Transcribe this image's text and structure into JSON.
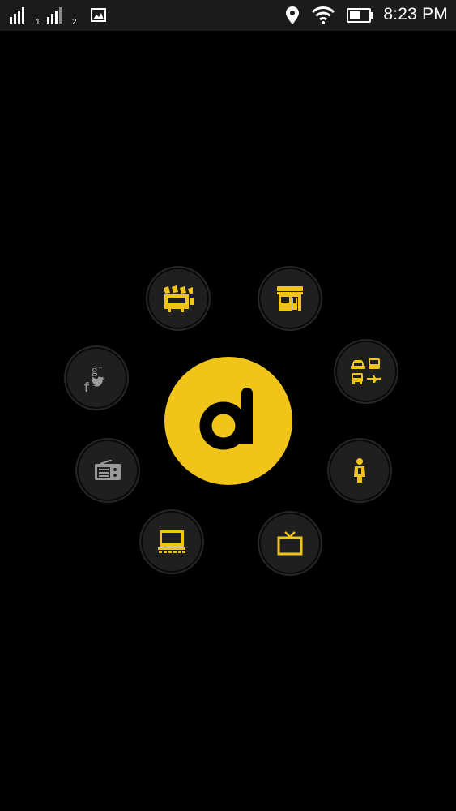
{
  "status_bar": {
    "sim1_label": "1",
    "sim2_label": "2",
    "time": "8:23 PM",
    "icons": [
      "signal-icon",
      "signal-icon",
      "gallery-icon",
      "location-icon",
      "wifi-icon",
      "battery-icon"
    ]
  },
  "colors": {
    "accent": "#f0c419",
    "muted_icon": "#9a9a9a",
    "bubble": "#1f1f1f",
    "background": "#000000"
  },
  "menu": {
    "logo_icon": "app-logo-d-icon",
    "items": [
      {
        "id": "movies",
        "icon": "clapperboard-icon",
        "active": true
      },
      {
        "id": "shop",
        "icon": "storefront-icon",
        "active": true
      },
      {
        "id": "social",
        "icon": "social-media-icon",
        "active": false
      },
      {
        "id": "transport",
        "icon": "transport-icon",
        "active": true
      },
      {
        "id": "radio",
        "icon": "radio-icon",
        "active": false
      },
      {
        "id": "person",
        "icon": "person-icon",
        "active": true
      },
      {
        "id": "theater",
        "icon": "theater-screen-icon",
        "active": true
      },
      {
        "id": "tv",
        "icon": "tv-icon",
        "active": true
      }
    ]
  }
}
